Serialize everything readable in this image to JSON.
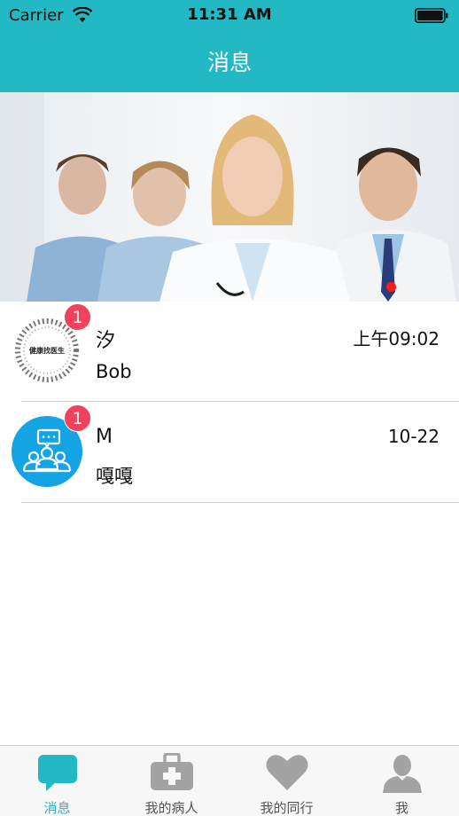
{
  "status_bar": {
    "carrier": "Carrier",
    "time": "11:31 AM"
  },
  "header": {
    "title": "消息",
    "background_color": "#22b8c4"
  },
  "banner": {
    "image": "four-doctors-photo",
    "page_indicator_color": "#ff1a1a"
  },
  "conversations": [
    {
      "name": "汐",
      "last_message": "Bob",
      "time": "上午09:02",
      "unread": "1",
      "avatar_text": "健康找医生",
      "avatar_icon": "circular-logo"
    },
    {
      "name": "M",
      "last_message": "嘎嘎",
      "time": "10-22",
      "unread": "1",
      "avatar_icon": "group-chat-icon",
      "avatar_color": "#14a4e6"
    }
  ],
  "tabbar": {
    "tabs": [
      {
        "label": "消息",
        "icon": "chat-bubble-icon",
        "active": true
      },
      {
        "label": "我的病人",
        "icon": "medical-kit-icon",
        "active": false
      },
      {
        "label": "我的同行",
        "icon": "heart-icon",
        "active": false
      },
      {
        "label": "我",
        "icon": "person-icon",
        "active": false
      }
    ],
    "active_color": "#22b8c4",
    "inactive_color": "#a3a3a3"
  }
}
